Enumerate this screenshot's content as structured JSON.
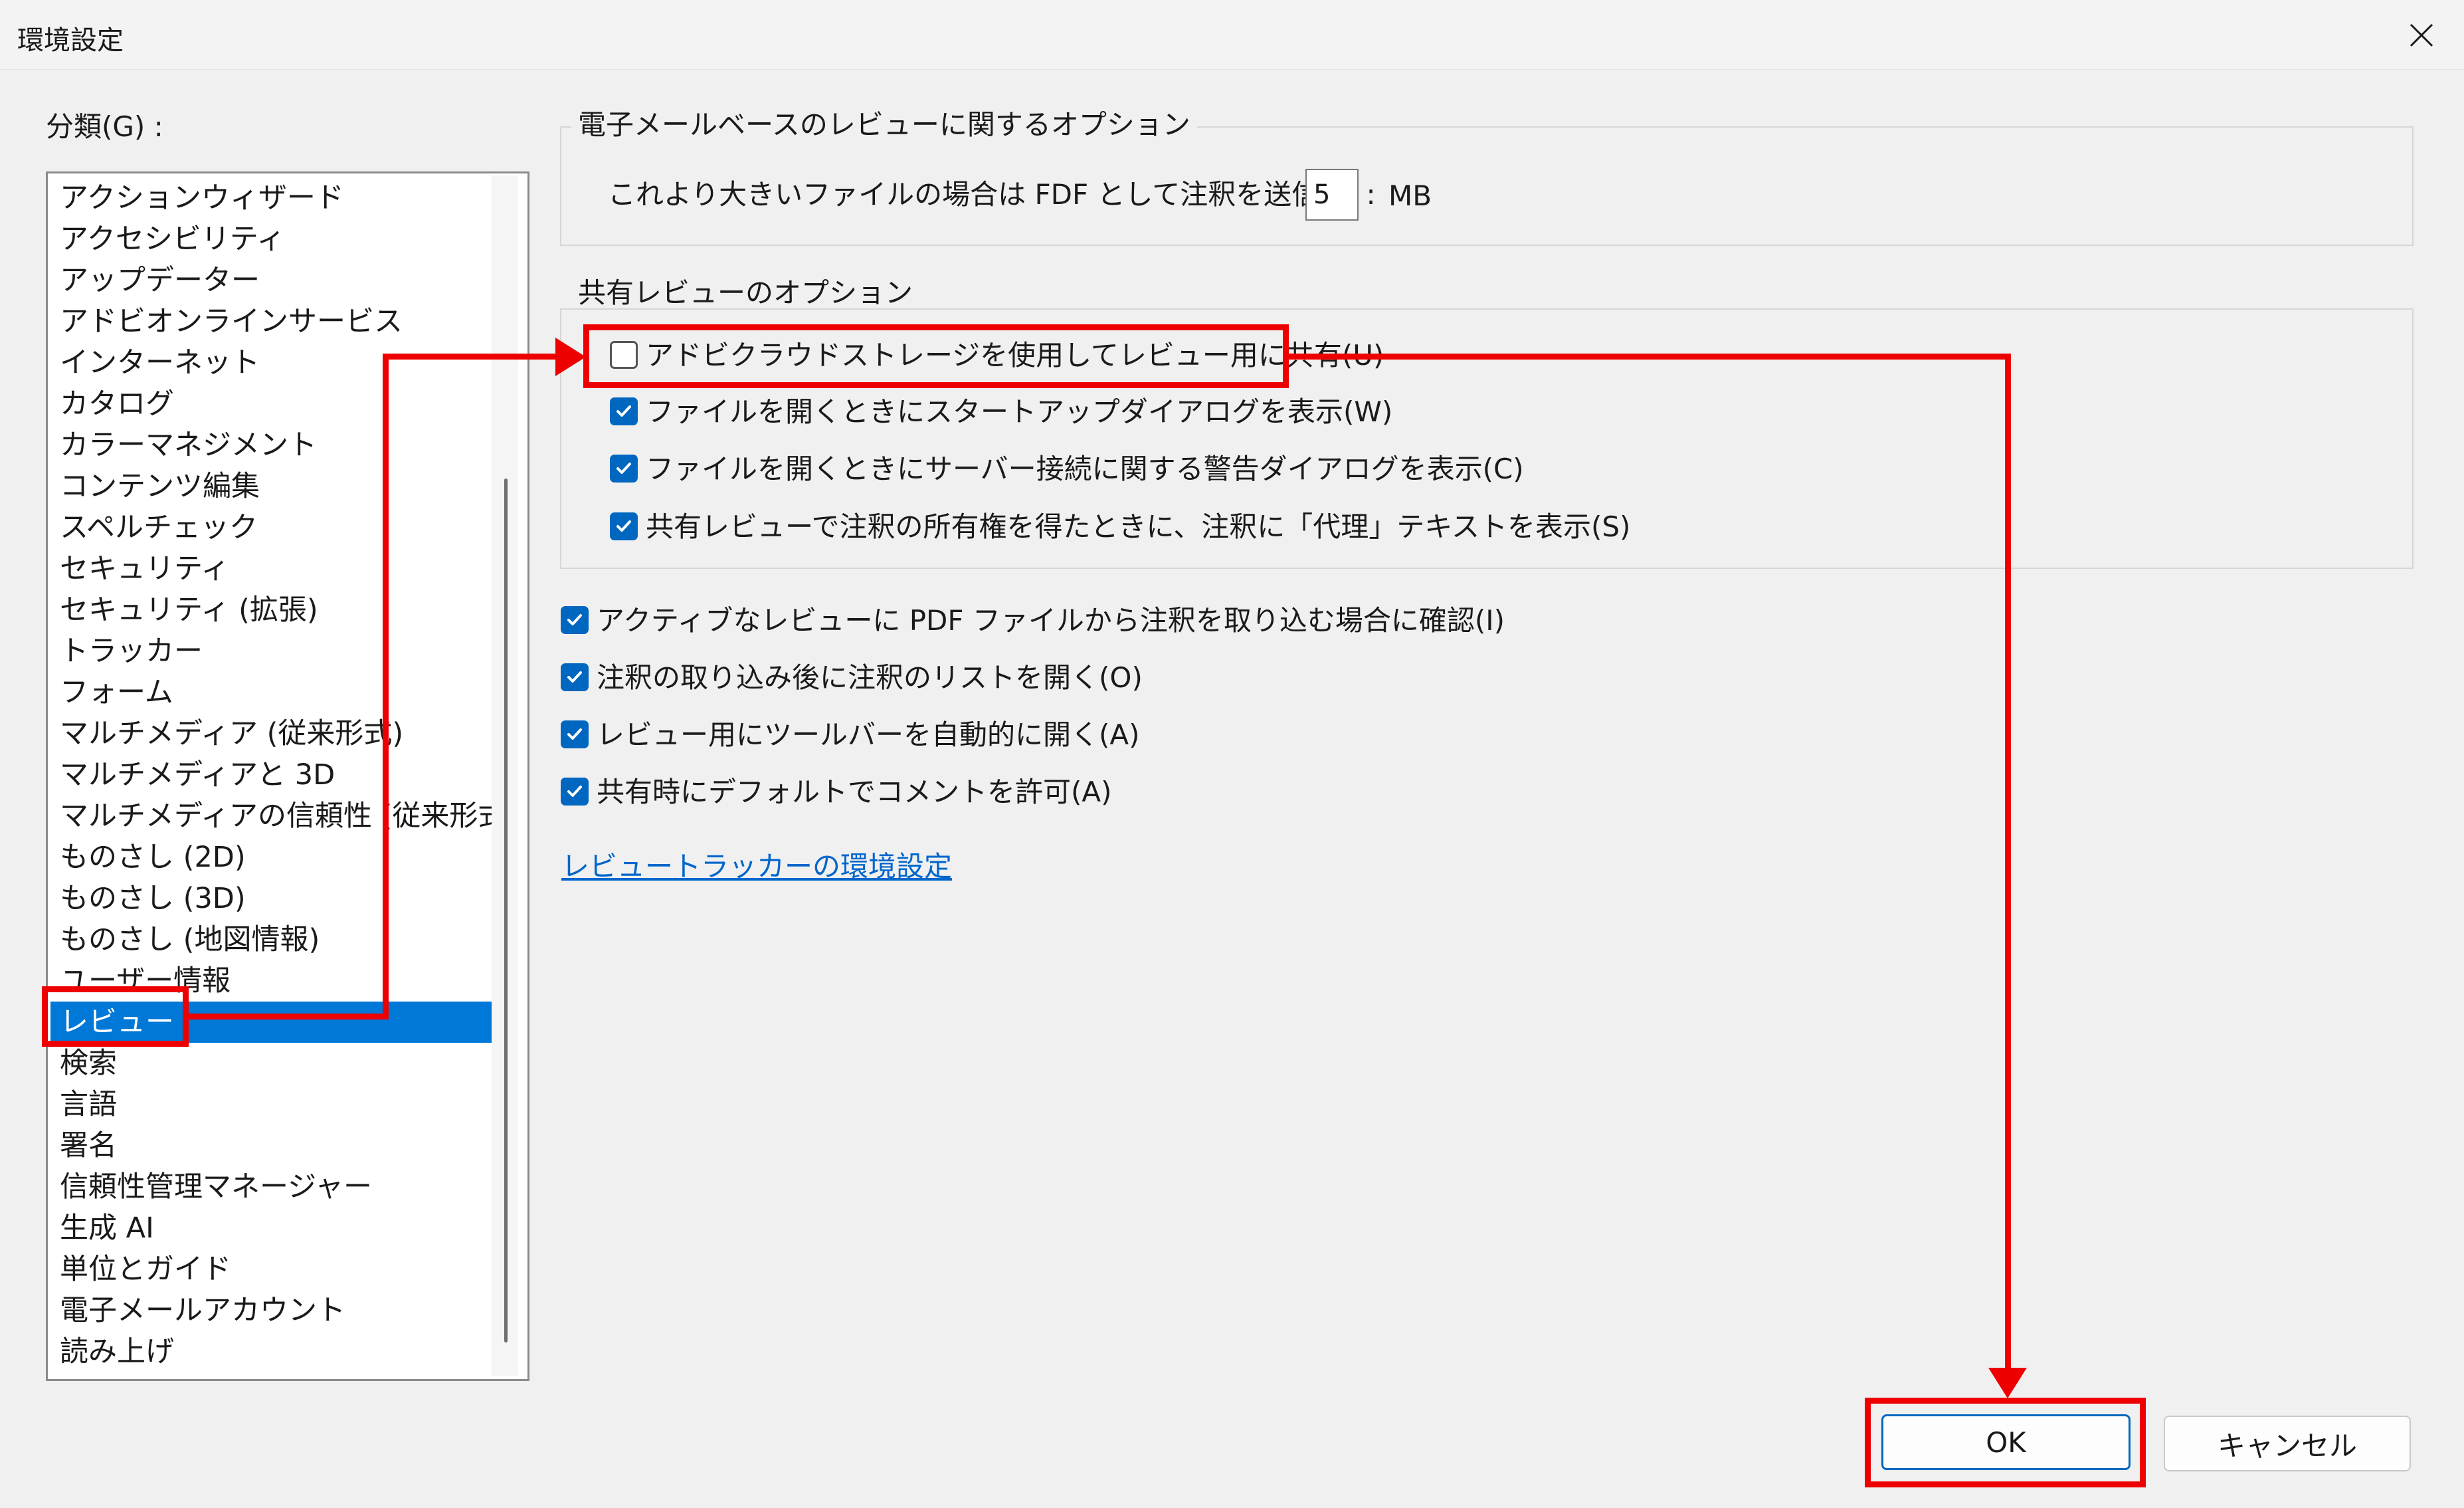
{
  "window": {
    "title": "環境設定",
    "close_icon": "close-icon"
  },
  "sidebar": {
    "label": "分類(G) :",
    "items": [
      {
        "label": "アクションウィザード"
      },
      {
        "label": "アクセシビリティ"
      },
      {
        "label": "アップデーター"
      },
      {
        "label": "アドビオンラインサービス"
      },
      {
        "label": "インターネット"
      },
      {
        "label": "カタログ"
      },
      {
        "label": "カラーマネジメント"
      },
      {
        "label": "コンテンツ編集"
      },
      {
        "label": "スペルチェック"
      },
      {
        "label": "セキュリティ"
      },
      {
        "label": "セキュリティ (拡張)"
      },
      {
        "label": "トラッカー"
      },
      {
        "label": "フォーム"
      },
      {
        "label": "マルチメディア (従来形式)"
      },
      {
        "label": "マルチメディアと 3D"
      },
      {
        "label": "マルチメディアの信頼性 (従来形式)"
      },
      {
        "label": "ものさし (2D)"
      },
      {
        "label": "ものさし (3D)"
      },
      {
        "label": "ものさし (地図情報)"
      },
      {
        "label": "ユーザー情報"
      },
      {
        "label": "レビュー",
        "selected": true
      },
      {
        "label": "検索"
      },
      {
        "label": "言語"
      },
      {
        "label": "署名"
      },
      {
        "label": "信頼性管理マネージャー"
      },
      {
        "label": "生成 AI"
      },
      {
        "label": "単位とガイド"
      },
      {
        "label": "電子メールアカウント"
      },
      {
        "label": "読み上げ"
      }
    ]
  },
  "email_review": {
    "title": "電子メールベースのレビューに関するオプション",
    "size_label": "これより大きいファイルの場合は FDF として注釈を送信(F) :",
    "size_value": "5",
    "size_unit": "MB"
  },
  "shared_review": {
    "title": "共有レビューのオプション",
    "options": [
      {
        "label": "アドビクラウドストレージを使用してレビュー用に共有(U)",
        "checked": false
      },
      {
        "label": "ファイルを開くときにスタートアップダイアログを表示(W)",
        "checked": true
      },
      {
        "label": "ファイルを開くときにサーバー接続に関する警告ダイアログを表示(C)",
        "checked": true
      },
      {
        "label": "共有レビューで注釈の所有権を得たときに、注釈に「代理」テキストを表示(S)",
        "checked": true
      }
    ]
  },
  "general_options": [
    {
      "label": "アクティブなレビューに PDF ファイルから注釈を取り込む場合に確認(I)",
      "checked": true
    },
    {
      "label": "注釈の取り込み後に注釈のリストを開く(O)",
      "checked": true
    },
    {
      "label": "レビュー用にツールバーを自動的に開く(A)",
      "checked": true
    },
    {
      "label": "共有時にデフォルトでコメントを許可(A)",
      "checked": true
    }
  ],
  "links": {
    "tracker": "レビュートラッカーの環境設定"
  },
  "buttons": {
    "ok": "OK",
    "cancel": "キャンセル"
  },
  "colors": {
    "accent": "#0067c0",
    "selection": "#0078d7",
    "annotation": "#ee0000",
    "link": "#0066cc"
  }
}
